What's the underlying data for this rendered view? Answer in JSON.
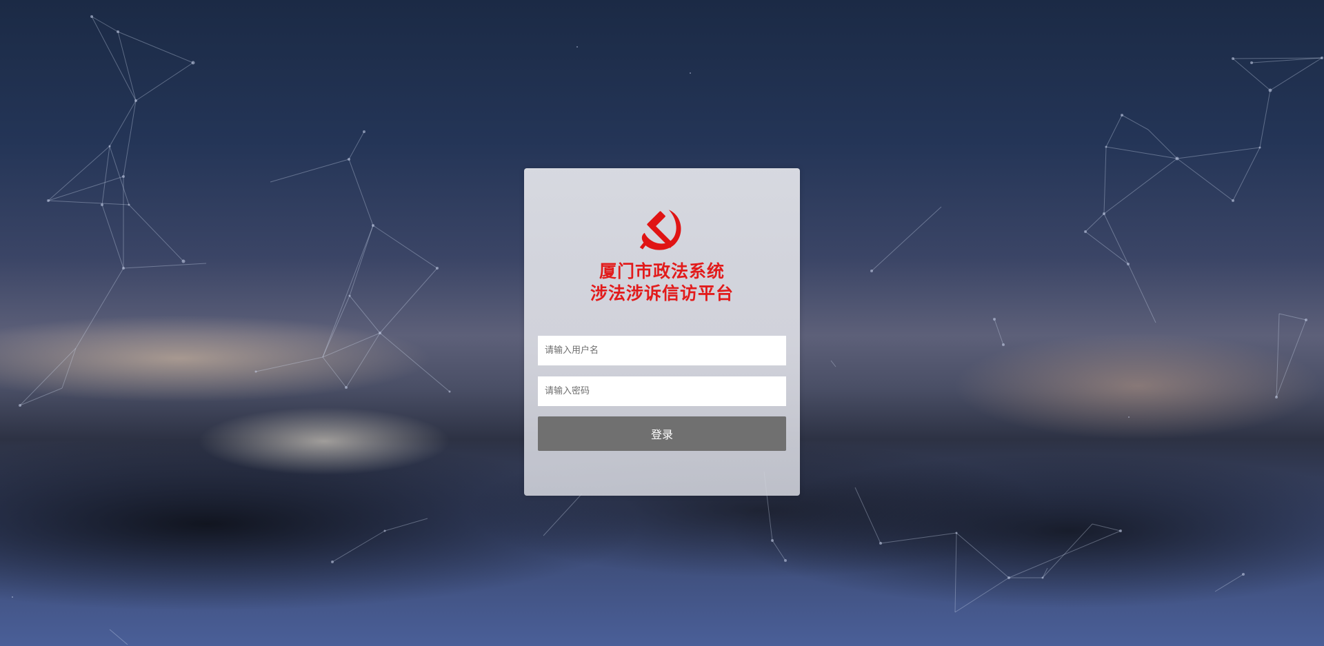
{
  "login": {
    "title_line1": "厦门市政法系统",
    "title_line2": "涉法涉诉信访平台",
    "username_placeholder": "请输入用户名",
    "password_placeholder": "请输入密码",
    "submit_label": "登录",
    "logo_icon": "hammer-sickle-icon"
  },
  "colors": {
    "title": "#e21b1b",
    "logo": "#e01414",
    "button": "#707070"
  }
}
